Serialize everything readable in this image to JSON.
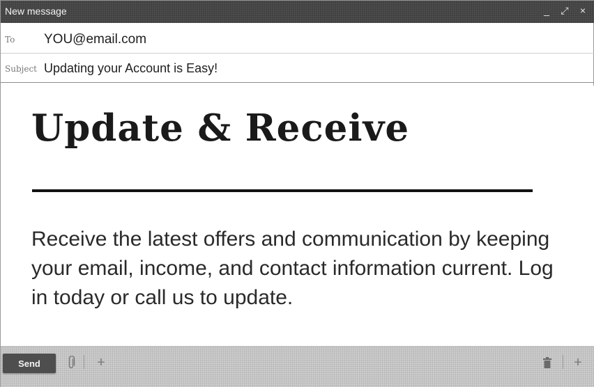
{
  "window": {
    "title": "New message",
    "controls": {
      "minimize": "_",
      "expand": "⤢",
      "close": "×"
    }
  },
  "to": {
    "label": "To",
    "value": "YOU@email.com"
  },
  "subject": {
    "label": "Subject",
    "value": "Updating your Account is Easy!"
  },
  "body": {
    "headline": "Update & Receive",
    "paragraph": "Receive the latest offers and communication by keeping your email, income, and contact information current. Log in today or call us to update."
  },
  "toolbar": {
    "send_label": "Send",
    "more_left": "+",
    "more_right": "+",
    "icons": [
      "paperclip-icon",
      "trash-icon"
    ]
  },
  "colors": {
    "titlebar": "#404040",
    "bottombar": "#cdcdcd",
    "send_button": "#4e4e4e"
  }
}
